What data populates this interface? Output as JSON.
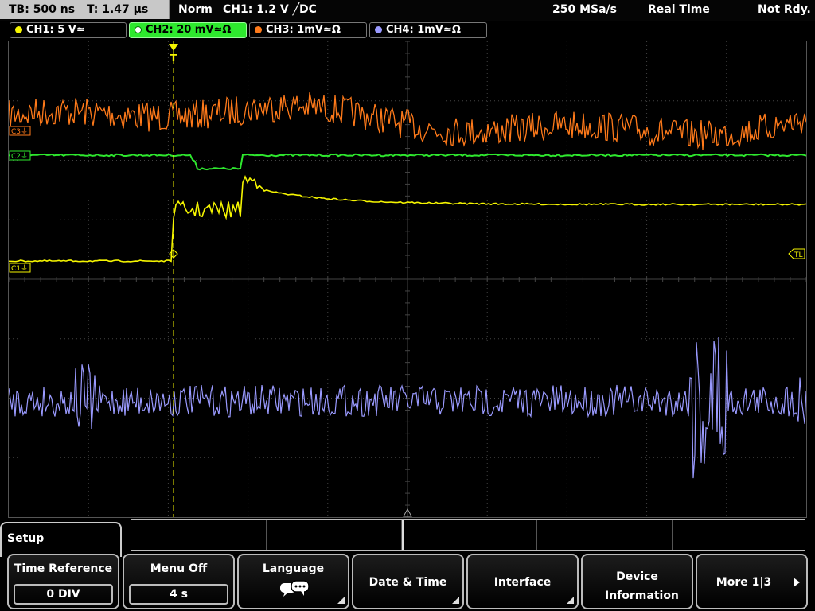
{
  "status": {
    "timebase": "TB: 500 ns",
    "trigger_time": "T: 1.47 µs",
    "mode": "Norm",
    "trigger_info": "CH1: 1.2 V ╱DC",
    "sample_rate": "250 MSa/s",
    "acq_mode": "Real Time",
    "state": "Not Rdy."
  },
  "channels": [
    {
      "label": "CH1: 5 V≃",
      "color": "#f5f500",
      "active": false
    },
    {
      "label": "CH2: 20 mV≃Ω",
      "color": "#2ee82e",
      "active": true
    },
    {
      "label": "CH3: 1mV≃Ω",
      "color": "#ff7a1a",
      "active": false
    },
    {
      "label": "CH4: 1mV≃Ω",
      "color": "#9a9aff",
      "active": false
    }
  ],
  "markers": {
    "c3": "C3⏚",
    "c2": "C2⏚",
    "c1": "C1⏚",
    "tl": "TL",
    "trigger": "T"
  },
  "menu": {
    "title": "Setup",
    "keys": [
      {
        "label": "Time Reference",
        "value": "0 DIV"
      },
      {
        "label": "Menu Off",
        "value": "4 s"
      },
      {
        "label": "Language",
        "icon": "speech-bubbles-icon"
      },
      {
        "label": "Date & Time"
      },
      {
        "label": "Interface"
      },
      {
        "label": "Device Information"
      },
      {
        "label": "More 1|3"
      }
    ]
  },
  "colors": {
    "ch1": "#f5f500",
    "ch2": "#2ee82e",
    "ch3": "#ff7a1a",
    "ch4": "#9a9aff",
    "grid": "#444444"
  }
}
